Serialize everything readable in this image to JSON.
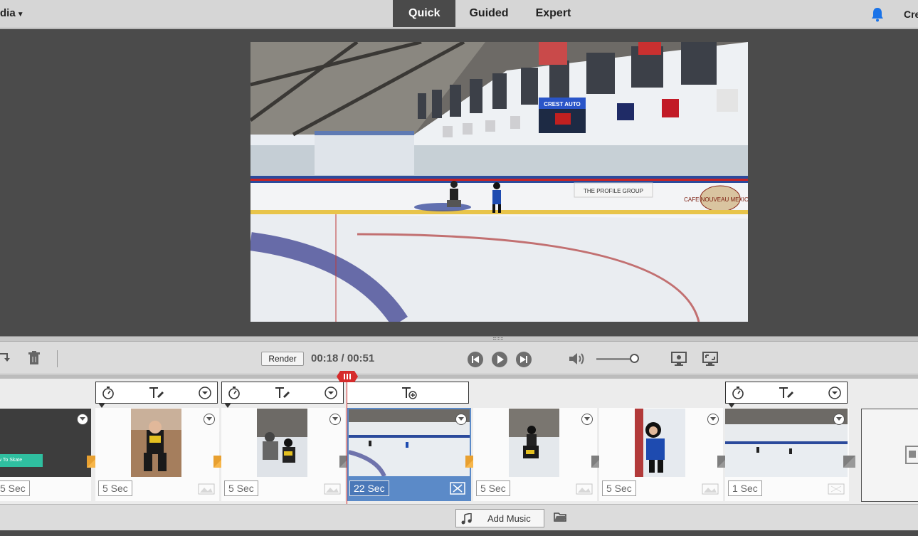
{
  "header": {
    "menu_label": "dia",
    "tabs": [
      {
        "label": "Quick",
        "active": true
      },
      {
        "label": "Guided",
        "active": false
      },
      {
        "label": "Expert",
        "active": false
      }
    ],
    "right_label": "Cre"
  },
  "controls": {
    "render_label": "Render",
    "timecode": "00:18 / 00:51",
    "volume_level": 0.85
  },
  "timeline": {
    "clips": [
      {
        "duration": "5 Sec",
        "thumb_text": "w To Skate",
        "selected": false
      },
      {
        "duration": "5 Sec",
        "selected": false
      },
      {
        "duration": "5 Sec",
        "selected": false
      },
      {
        "duration": "22 Sec",
        "selected": true
      },
      {
        "duration": "5 Sec",
        "selected": false
      },
      {
        "duration": "5 Sec",
        "selected": false
      },
      {
        "duration": "1 Sec",
        "selected": false
      }
    ],
    "add_music_label": "Add Music"
  },
  "preview": {
    "scoreboard_label": "CREST AUTO",
    "board_texts": [
      "THE PROFILE GROUP",
      "CAFE NOUVEAU MEXICAN"
    ]
  },
  "colors": {
    "accent_active_tab": "#4a4a4a",
    "selected_clip": "#5b8ac8",
    "playhead": "#d62b2b",
    "bell": "#1a73e8"
  }
}
